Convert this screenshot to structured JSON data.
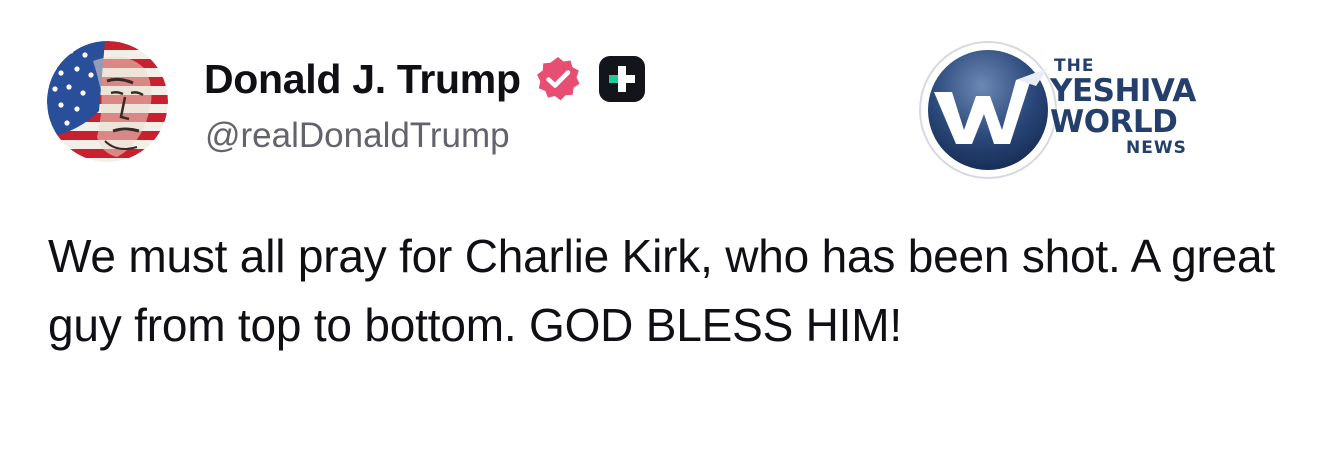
{
  "post": {
    "author": {
      "display_name": "Donald J. Trump",
      "handle": "@realDonaldTrump",
      "verified": true,
      "badge_icon": "verified-badge-icon",
      "extra_icon": "plus-icon"
    },
    "text": "We must all pray for Charlie Kirk, who has been shot. A great guy from top to bottom. GOD BLESS HIM!"
  },
  "watermark": {
    "line1": "THE",
    "line2": "YESHIVA",
    "line3": "WORLD",
    "line4": "NEWS",
    "icon": "yeshiva-world-news-logo"
  },
  "colors": {
    "text": "#0f0f14",
    "handle": "#63636e",
    "verified_badge": "#e64f72",
    "plus_badge": "#14141b",
    "plus_badge_accent": "#20c997",
    "watermark_blue": "#243f6c"
  }
}
